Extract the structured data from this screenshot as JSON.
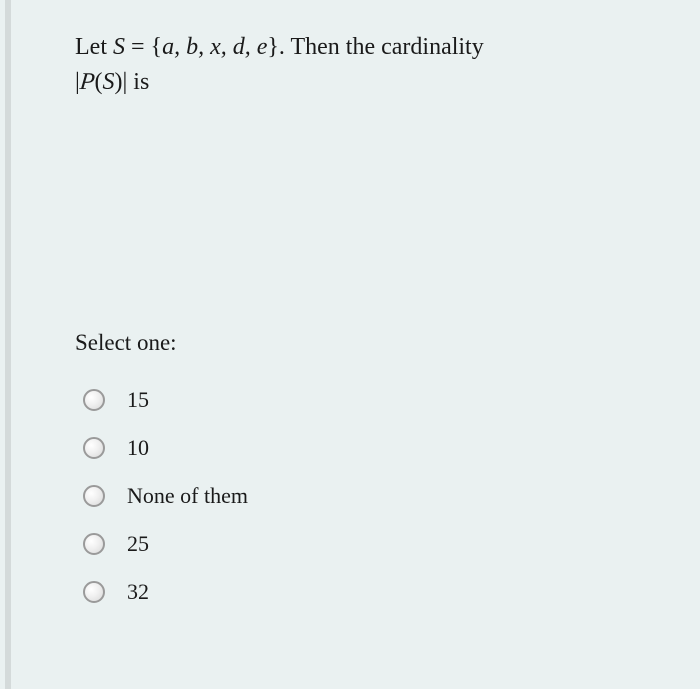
{
  "question": {
    "line1_pre": "Let ",
    "set_var": "S",
    "equals": " = ",
    "set_open": "{",
    "set_members": "a, b, x, d, e",
    "set_close": "}",
    "line1_post": ". Then the cardinality",
    "line2_pre": "|",
    "power": "P",
    "line2_mid": "(",
    "line2_var": "S",
    "line2_close": ")|",
    "line2_post": "  is"
  },
  "prompt": "Select one:",
  "options": [
    {
      "label": "15"
    },
    {
      "label": "10"
    },
    {
      "label": "None of them"
    },
    {
      "label": "25"
    },
    {
      "label": "32"
    }
  ]
}
